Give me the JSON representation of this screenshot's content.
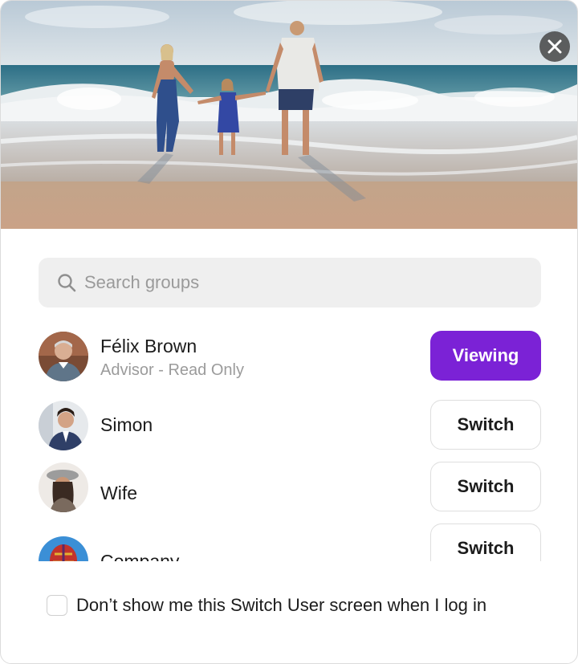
{
  "close": {
    "icon": "close-icon"
  },
  "search": {
    "placeholder": "Search groups",
    "value": "",
    "icon": "search-icon"
  },
  "users": [
    {
      "name": "Félix Brown",
      "role": "Advisor - Read Only",
      "action": "Viewing",
      "active": true
    },
    {
      "name": "Simon",
      "role": "",
      "action": "Switch",
      "active": false
    },
    {
      "name": "Wife",
      "role": "",
      "action": "Switch",
      "active": false
    },
    {
      "name": "Company",
      "role": "",
      "action": "Switch",
      "active": false
    }
  ],
  "footer": {
    "checkbox_checked": false,
    "label": "Don’t show me this Switch User screen when I log in"
  },
  "colors": {
    "accent": "#7b22d6",
    "search_bg": "#efefef",
    "muted_text": "#9b9b9b"
  }
}
